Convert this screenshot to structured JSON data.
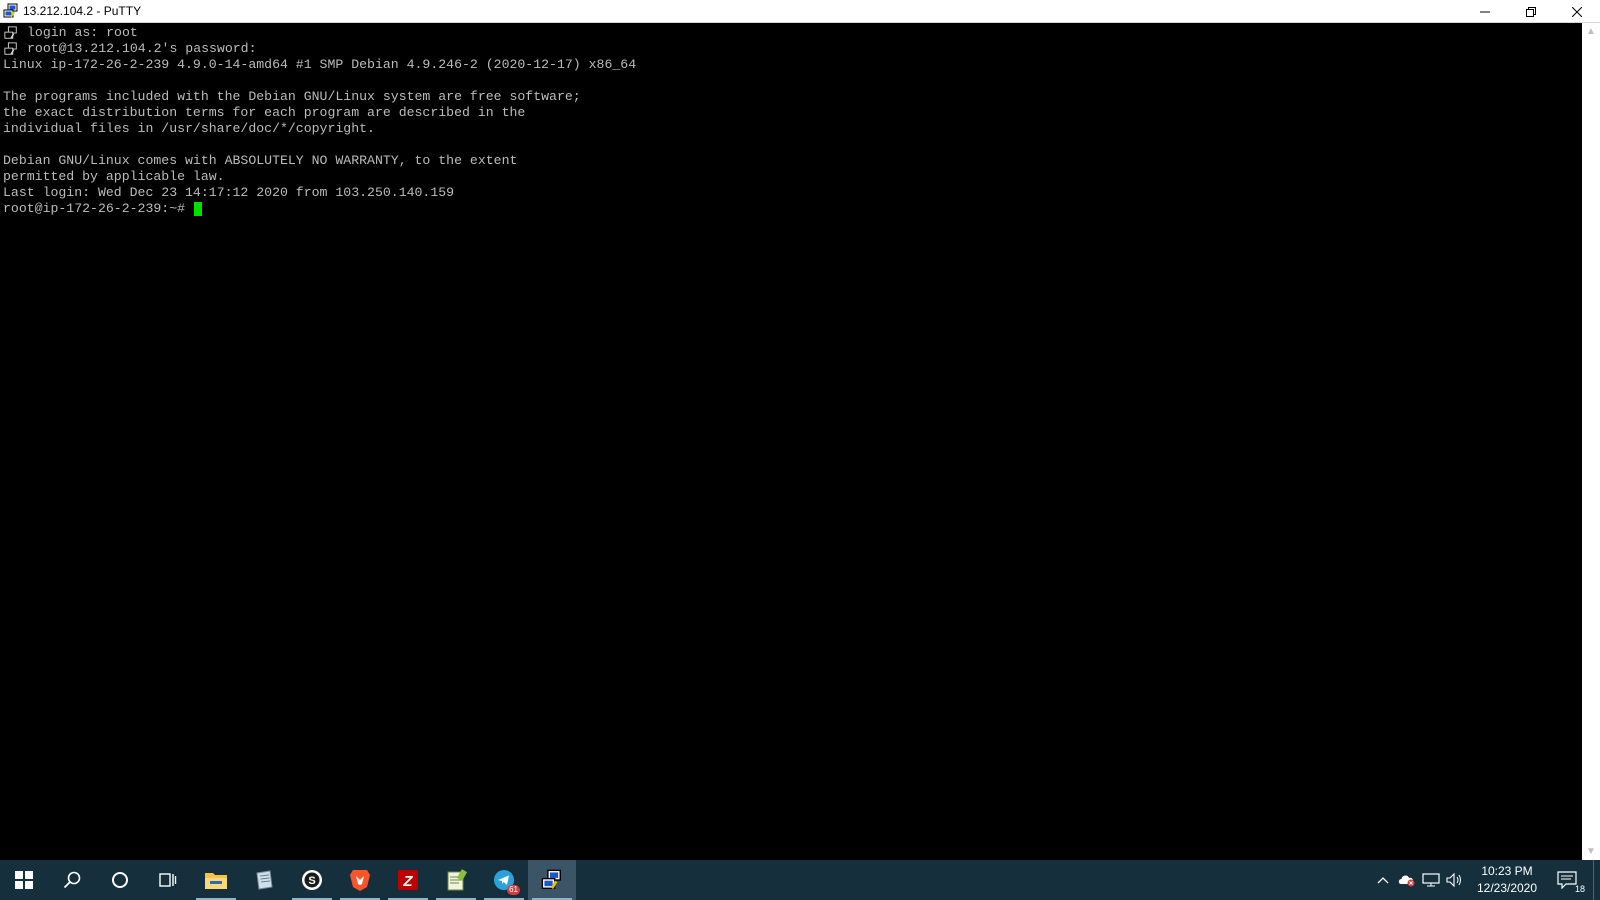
{
  "window": {
    "title": "13.212.104.2 - PuTTY"
  },
  "terminal": {
    "lines": [
      {
        "icon": true,
        "text": "login as: root"
      },
      {
        "icon": true,
        "text": "root@13.212.104.2's password:"
      },
      {
        "icon": false,
        "text": "Linux ip-172-26-2-239 4.9.0-14-amd64 #1 SMP Debian 4.9.246-2 (2020-12-17) x86_64"
      },
      {
        "icon": false,
        "text": ""
      },
      {
        "icon": false,
        "text": "The programs included with the Debian GNU/Linux system are free software;"
      },
      {
        "icon": false,
        "text": "the exact distribution terms for each program are described in the"
      },
      {
        "icon": false,
        "text": "individual files in /usr/share/doc/*/copyright."
      },
      {
        "icon": false,
        "text": ""
      },
      {
        "icon": false,
        "text": "Debian GNU/Linux comes with ABSOLUTELY NO WARRANTY, to the extent"
      },
      {
        "icon": false,
        "text": "permitted by applicable law."
      },
      {
        "icon": false,
        "text": "Last login: Wed Dec 23 14:17:12 2020 from 103.250.140.159"
      }
    ],
    "prompt": "root@ip-172-26-2-239:~#",
    "cursor_color": "#00e000",
    "text_color": "#bbbbbb"
  },
  "taskbar": {
    "telegram_badge": "61",
    "clock_time": "10:23 PM",
    "clock_date": "12/23/2020",
    "notification_count": "18"
  }
}
